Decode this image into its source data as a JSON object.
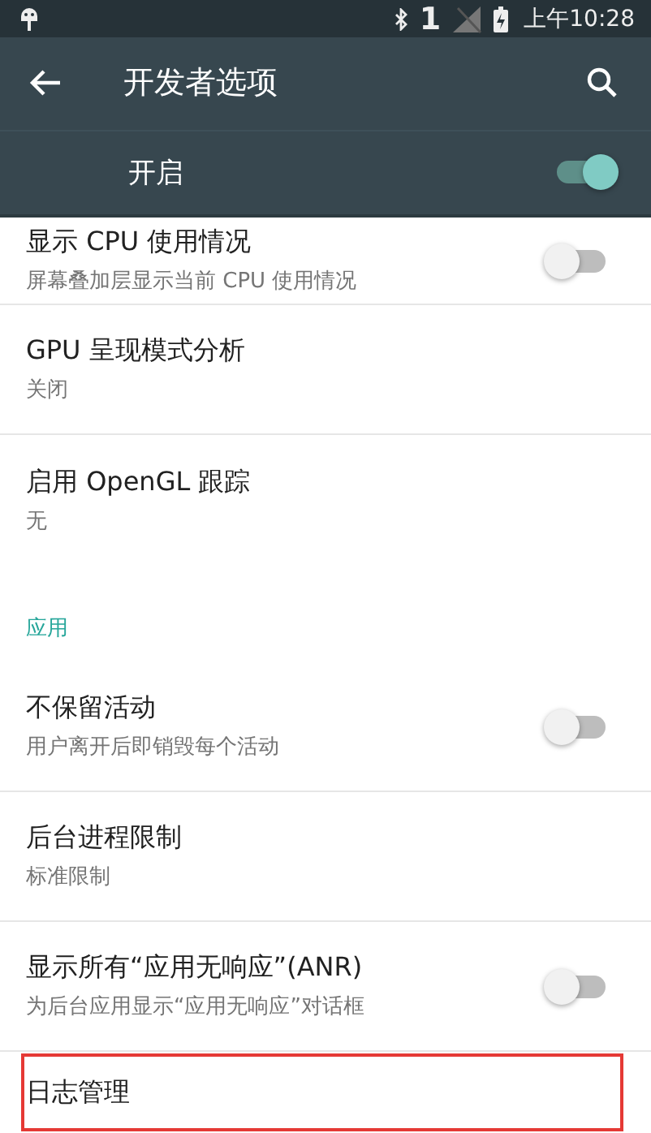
{
  "status_bar": {
    "signal_text": "1",
    "time": "上午10:28"
  },
  "toolbar": {
    "title": "开发者选项"
  },
  "master_switch": {
    "label": "开启",
    "on": true
  },
  "items": [
    {
      "kind": "switch",
      "title": "显示 CPU 使用情况",
      "summary": "屏幕叠加层显示当前 CPU 使用情况",
      "on": false,
      "highlighted": false
    },
    {
      "kind": "text",
      "title": "GPU 呈现模式分析",
      "summary": "关闭",
      "highlighted": false
    },
    {
      "kind": "text",
      "title": "启用 OpenGL 跟踪",
      "summary": "无",
      "highlighted": false
    },
    {
      "kind": "category",
      "title": "应用"
    },
    {
      "kind": "switch",
      "title": "不保留活动",
      "summary": "用户离开后即销毁每个活动",
      "on": false,
      "highlighted": false
    },
    {
      "kind": "text",
      "title": "后台进程限制",
      "summary": "标准限制",
      "highlighted": false
    },
    {
      "kind": "switch",
      "title": "显示所有“应用无响应”(ANR)",
      "summary": "为后台应用显示“应用无响应”对话框",
      "on": false,
      "highlighted": false
    },
    {
      "kind": "text",
      "title": "日志管理",
      "highlighted": true
    }
  ]
}
